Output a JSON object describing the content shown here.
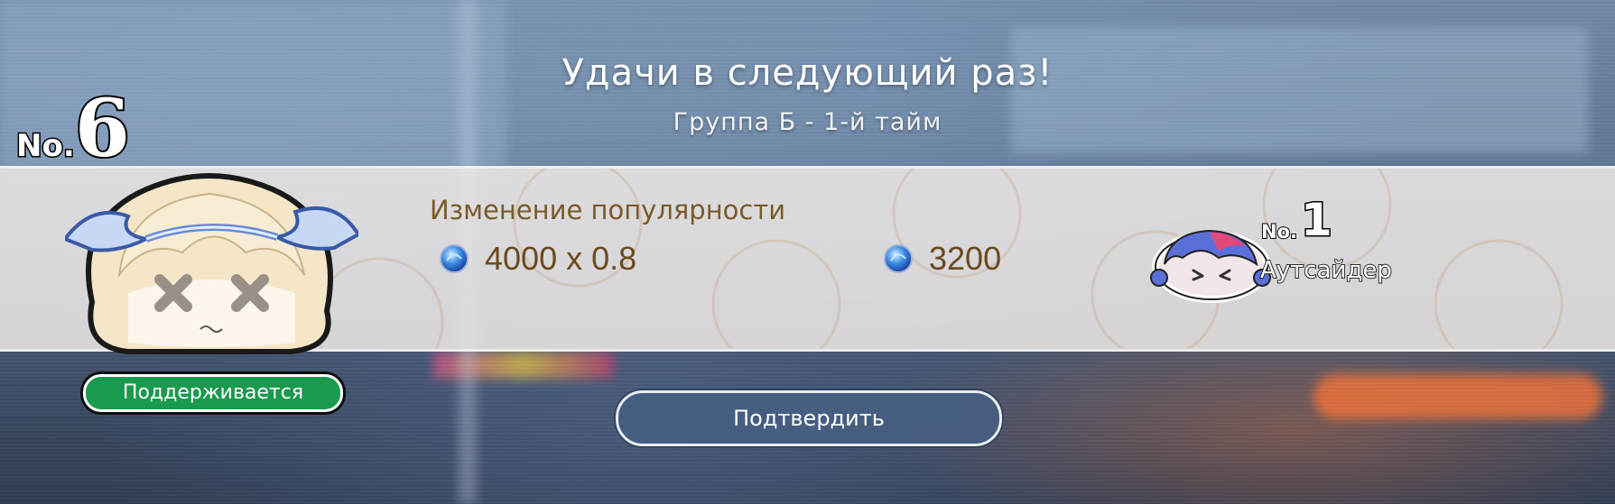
{
  "header": {
    "title": "Удачи в следующий раз!",
    "subtitle": "Группа Б - 1-й тайм"
  },
  "player": {
    "rank_prefix": "No.",
    "rank": "6",
    "status": "Поддерживается"
  },
  "popularity": {
    "label": "Изменение популярности",
    "formula": "4000 x 0.8",
    "result": "3200",
    "icon": "blue-gem-icon"
  },
  "opponent": {
    "rank_prefix": "No.",
    "rank": "1",
    "title": "Аутсайдер"
  },
  "actions": {
    "confirm_label": "Подтвердить"
  },
  "colors": {
    "status_green": "#1a9a4e",
    "label_brown": "#7a5a2a",
    "button_blue": "#465f82"
  }
}
